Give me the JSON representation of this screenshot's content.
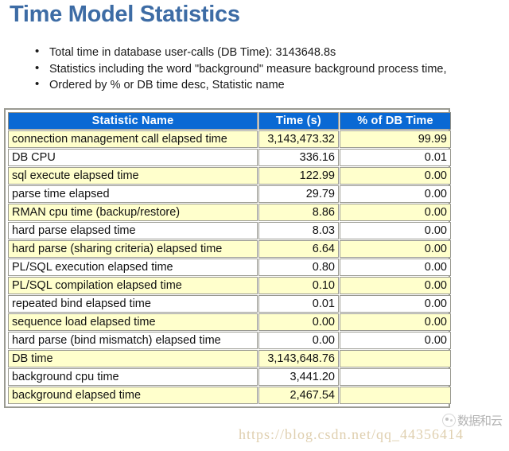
{
  "page": {
    "title": "Time Model Statistics",
    "title_color": "#3d6ca5"
  },
  "notes": [
    "Total time in database user-calls (DB Time): 3143648.8s",
    "Statistics including the word \"background\" measure background process time,",
    "Ordered by % or DB time desc, Statistic name"
  ],
  "table": {
    "header_bg": "#0a69d4",
    "row_alt_bg": "#ffffcc",
    "columns": [
      "Statistic Name",
      "Time (s)",
      "% of DB Time"
    ],
    "rows": [
      {
        "name": "connection management call elapsed time",
        "time": "3,143,473.32",
        "pct": "99.99"
      },
      {
        "name": "DB CPU",
        "time": "336.16",
        "pct": "0.01"
      },
      {
        "name": "sql execute elapsed time",
        "time": "122.99",
        "pct": "0.00"
      },
      {
        "name": "parse time elapsed",
        "time": "29.79",
        "pct": "0.00"
      },
      {
        "name": "RMAN cpu time (backup/restore)",
        "time": "8.86",
        "pct": "0.00"
      },
      {
        "name": "hard parse elapsed time",
        "time": "8.03",
        "pct": "0.00"
      },
      {
        "name": "hard parse (sharing criteria) elapsed time",
        "time": "6.64",
        "pct": "0.00"
      },
      {
        "name": "PL/SQL execution elapsed time",
        "time": "0.80",
        "pct": "0.00"
      },
      {
        "name": "PL/SQL compilation elapsed time",
        "time": "0.10",
        "pct": "0.00"
      },
      {
        "name": "repeated bind elapsed time",
        "time": "0.01",
        "pct": "0.00"
      },
      {
        "name": "sequence load elapsed time",
        "time": "0.00",
        "pct": "0.00"
      },
      {
        "name": "hard parse (bind mismatch) elapsed time",
        "time": "0.00",
        "pct": "0.00"
      },
      {
        "name": "DB time",
        "time": "3,143,648.76",
        "pct": ""
      },
      {
        "name": "background cpu time",
        "time": "3,441.20",
        "pct": ""
      },
      {
        "name": "background elapsed time",
        "time": "2,467.54",
        "pct": ""
      }
    ]
  },
  "watermarks": {
    "url": "https://blog.csdn.net/qq_44356414",
    "brand_cn": "数据和云"
  }
}
